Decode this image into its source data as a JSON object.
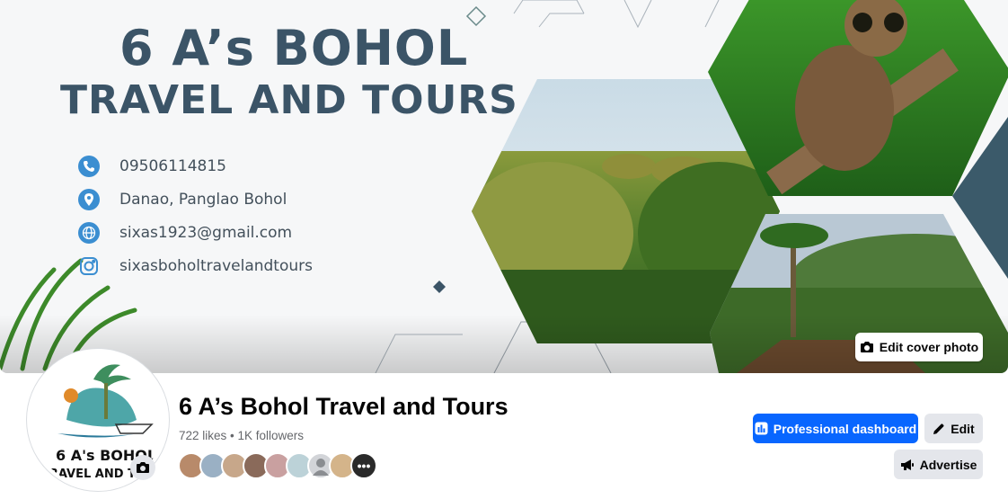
{
  "cover": {
    "title_line1": "6 A’s BOHOL",
    "title_line2": "TRAVEL AND TOURS",
    "contacts": [
      {
        "icon": "phone-icon",
        "text": "09506114815"
      },
      {
        "icon": "location-pin-icon",
        "text": "Danao, Panglao Bohol"
      },
      {
        "icon": "globe-icon",
        "text": "sixas1923@gmail.com"
      },
      {
        "icon": "instagram-icon",
        "text": "sixasboholtravelandtours"
      }
    ],
    "edit_cover_label": "Edit cover photo"
  },
  "profile": {
    "avatar_text_line1": "6 A's BOHOL",
    "avatar_text_line2": "TRAVEL AND TOU",
    "name": "6 A’s Bohol Travel and Tours",
    "stats": "722 likes • 1K followers"
  },
  "actions": {
    "professional_dashboard": "Professional dashboard",
    "edit": "Edit",
    "advertise": "Advertise"
  },
  "colors": {
    "accent": "#0866ff",
    "title": "#3b5467",
    "contact_icon": "#3b8ed1"
  }
}
